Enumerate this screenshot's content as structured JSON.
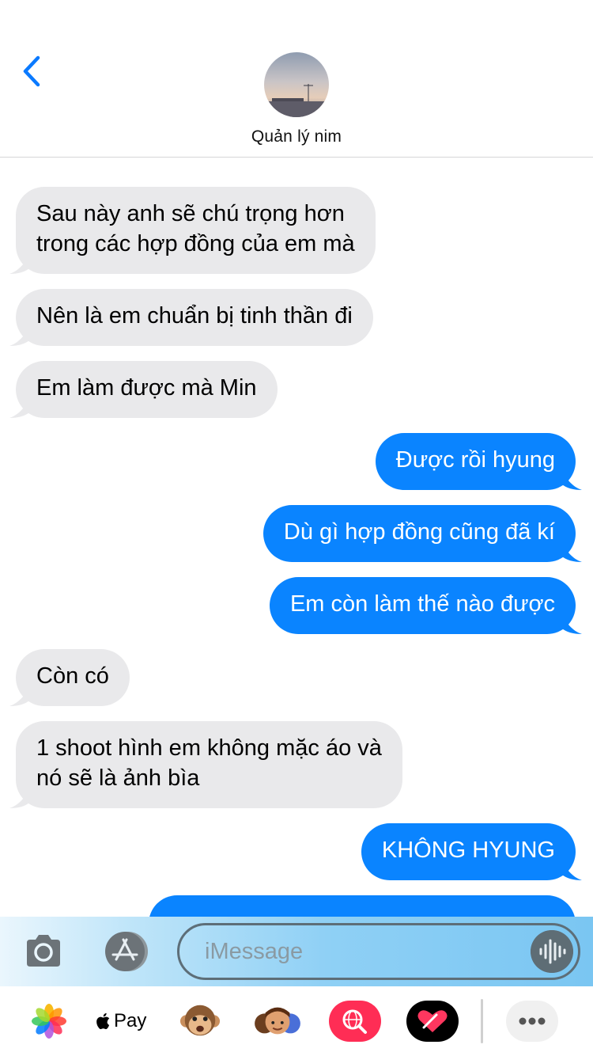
{
  "contact": {
    "name": "Quản lý nim"
  },
  "messages": [
    {
      "dir": "in",
      "text": "Sau này anh sẽ chú trọng hơn\ntrong các hợp đồng của em mà"
    },
    {
      "dir": "in",
      "text": "Nên là em chuẩn bị tinh thần đi"
    },
    {
      "dir": "in",
      "text": "Em làm được mà Min"
    },
    {
      "dir": "out",
      "text": "Được rồi hyung"
    },
    {
      "dir": "out",
      "text": "Dù gì hợp đồng cũng đã kí"
    },
    {
      "dir": "out",
      "text": "Em còn làm thế nào được"
    },
    {
      "dir": "in",
      "text": "Còn có"
    },
    {
      "dir": "in",
      "text": "1 shoot hình em không mặc áo và\nnó sẽ là ảnh bìa"
    },
    {
      "dir": "out",
      "text": "KHÔNG HYUNG"
    },
    {
      "dir": "out",
      "text": ""
    }
  ],
  "input": {
    "placeholder": "iMessage"
  },
  "app_drawer": {
    "apple_pay_label": "Pay",
    "items": [
      "photos-icon",
      "apple-pay-icon",
      "monkey-animoji-icon",
      "memoji-icon",
      "web-search-icon",
      "digital-touch-icon",
      "more-apps-icon"
    ]
  },
  "colors": {
    "outgoing": "#0a84ff",
    "incoming": "#e9e9eb",
    "accent": "#0a7aff"
  }
}
